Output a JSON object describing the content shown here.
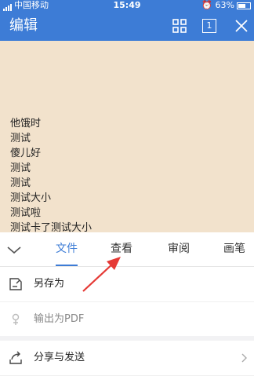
{
  "status_bar": {
    "carrier": "中国移动",
    "time": "15:49",
    "battery": "63%"
  },
  "title_bar": {
    "title": "编辑",
    "icons": [
      "grid-icon",
      "page-count-icon",
      "close-icon"
    ],
    "page_badge": "1"
  },
  "document": {
    "lines": [
      "他饿时",
      "测试",
      "傻儿好",
      "测试",
      "测试",
      "测试大小",
      "测试啦",
      "测试卡了测试大小"
    ]
  },
  "toolbar": {
    "tabs": [
      {
        "label": "文件",
        "active": true
      },
      {
        "label": "查看",
        "active": false
      },
      {
        "label": "审阅",
        "active": false
      },
      {
        "label": "画笔",
        "active": false
      }
    ]
  },
  "menu": {
    "items": [
      {
        "label": "另存为",
        "icon": "save-as-icon",
        "enabled": true
      },
      {
        "label": "输出为PDF",
        "icon": "export-pdf-icon",
        "enabled": false
      },
      {
        "label": "分享与发送",
        "icon": "share-icon",
        "enabled": true
      }
    ]
  },
  "colors": {
    "accent": "#3d7cd6",
    "document_bg": "#f2e2cc",
    "annotation_arrow": "#e53935"
  }
}
